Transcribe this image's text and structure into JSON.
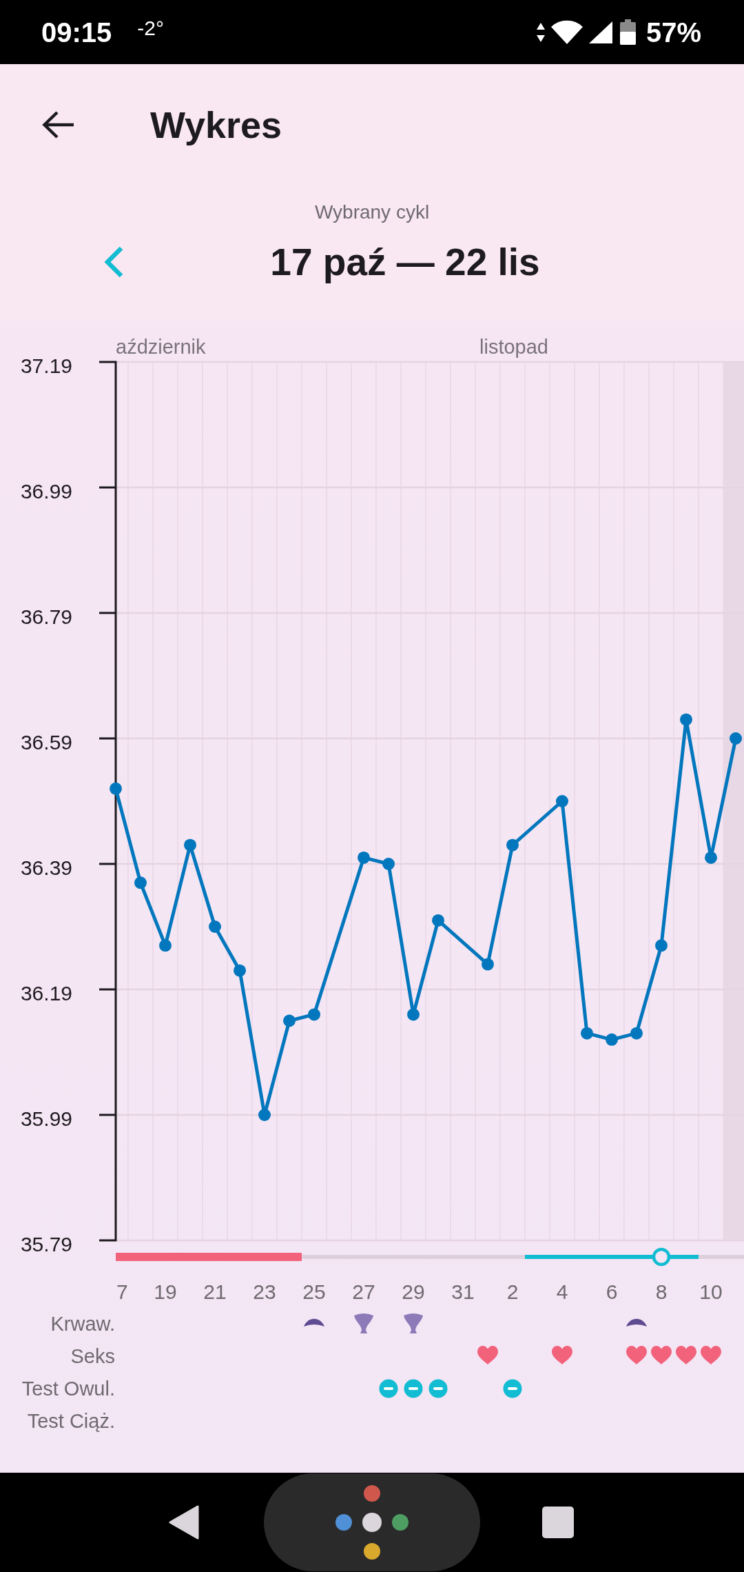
{
  "status_bar": {
    "time": "09:15",
    "temperature": "-2°",
    "battery": "57%"
  },
  "app_bar": {
    "title": "Wykres"
  },
  "cycle_selector": {
    "caption": "Wybrany cykl",
    "range": "17 paź — 22 lis"
  },
  "chart": {
    "chart_data": {
      "type": "line",
      "grid": true,
      "categories": [
        "7",
        null,
        "19",
        null,
        "21",
        null,
        "23",
        null,
        "25",
        null,
        "27",
        null,
        "29",
        null,
        "31",
        null,
        "2",
        null,
        "4",
        null,
        "6",
        null,
        "8",
        null,
        "10",
        null
      ],
      "series": [
        {
          "color": "#0277bd",
          "marker": "circle",
          "values": [
            36.51,
            36.36,
            36.26,
            36.42,
            36.29,
            36.22,
            35.99,
            36.14,
            36.15,
            null,
            36.4,
            36.39,
            36.15,
            36.3,
            null,
            36.23,
            36.42,
            null,
            36.49,
            36.12,
            36.11,
            36.12,
            36.26,
            36.62,
            36.4,
            36.59
          ]
        }
      ],
      "ylim": [
        35.79,
        37.19
      ],
      "yticks": [
        37.19,
        36.99,
        36.79,
        36.59,
        36.39,
        36.19,
        35.99,
        35.79
      ]
    },
    "day_columns": [
      {
        "kind": "plain",
        "month": "aździernik"
      },
      {
        "kind": "plain"
      },
      {
        "kind": "plain"
      },
      {
        "kind": "plain"
      },
      {
        "kind": "plain"
      },
      {
        "kind": "plain"
      },
      {
        "kind": "plain"
      },
      {
        "kind": "plain"
      },
      {
        "kind": "plain"
      },
      {
        "kind": "plain"
      },
      {
        "kind": "plain"
      },
      {
        "kind": "plain"
      },
      {
        "kind": "plain"
      },
      {
        "kind": "plain"
      },
      {
        "kind": "plain"
      },
      {
        "kind": "plain",
        "month": "listopad"
      },
      {
        "kind": "plain"
      },
      {
        "kind": "plain"
      },
      {
        "kind": "plain"
      },
      {
        "kind": "plain"
      },
      {
        "kind": "plain"
      },
      {
        "kind": "plain"
      },
      {
        "kind": "plain"
      },
      {
        "kind": "plain"
      },
      {
        "kind": "plain"
      },
      {
        "kind": "highlighted"
      }
    ],
    "phase_bar": [
      {
        "kind": "period"
      },
      {
        "kind": "period"
      },
      {
        "kind": "period"
      },
      {
        "kind": "period"
      },
      {
        "kind": "period"
      },
      {
        "kind": "period"
      },
      {
        "kind": "period"
      },
      {
        "kind": "period"
      },
      {
        "kind": "none"
      },
      {
        "kind": "none"
      },
      {
        "kind": "none"
      },
      {
        "kind": "none"
      },
      {
        "kind": "none"
      },
      {
        "kind": "none"
      },
      {
        "kind": "none"
      },
      {
        "kind": "none"
      },
      {
        "kind": "none"
      },
      {
        "kind": "fertile"
      },
      {
        "kind": "fertile"
      },
      {
        "kind": "fertile"
      },
      {
        "kind": "fertile"
      },
      {
        "kind": "fertile"
      },
      {
        "kind": "ovulation"
      },
      {
        "kind": "fertile"
      },
      {
        "kind": "none"
      },
      {
        "kind": "none"
      }
    ],
    "event_rows": [
      {
        "label": "Krwaw.",
        "days": [
          {
            "kind": "none"
          },
          {
            "kind": "none"
          },
          {
            "kind": "none"
          },
          {
            "kind": "none"
          },
          {
            "kind": "none"
          },
          {
            "kind": "none"
          },
          {
            "kind": "none"
          },
          {
            "kind": "none"
          },
          {
            "kind": "dome"
          },
          {
            "kind": "none"
          },
          {
            "kind": "goblet"
          },
          {
            "kind": "none"
          },
          {
            "kind": "goblet"
          },
          {
            "kind": "none"
          },
          {
            "kind": "none"
          },
          {
            "kind": "none"
          },
          {
            "kind": "none"
          },
          {
            "kind": "none"
          },
          {
            "kind": "none"
          },
          {
            "kind": "none"
          },
          {
            "kind": "none"
          },
          {
            "kind": "dome"
          },
          {
            "kind": "none"
          },
          {
            "kind": "none"
          },
          {
            "kind": "none"
          },
          {
            "kind": "none"
          }
        ]
      },
      {
        "label": "Seks",
        "days": [
          {
            "kind": "none"
          },
          {
            "kind": "none"
          },
          {
            "kind": "none"
          },
          {
            "kind": "none"
          },
          {
            "kind": "none"
          },
          {
            "kind": "none"
          },
          {
            "kind": "none"
          },
          {
            "kind": "none"
          },
          {
            "kind": "none"
          },
          {
            "kind": "none"
          },
          {
            "kind": "none"
          },
          {
            "kind": "none"
          },
          {
            "kind": "none"
          },
          {
            "kind": "none"
          },
          {
            "kind": "none"
          },
          {
            "kind": "heart"
          },
          {
            "kind": "none"
          },
          {
            "kind": "none"
          },
          {
            "kind": "heart"
          },
          {
            "kind": "none"
          },
          {
            "kind": "none"
          },
          {
            "kind": "heart"
          },
          {
            "kind": "heart"
          },
          {
            "kind": "heart"
          },
          {
            "kind": "heart"
          },
          {
            "kind": "none"
          }
        ]
      },
      {
        "label": "Test Owul.",
        "days": [
          {
            "kind": "none"
          },
          {
            "kind": "none"
          },
          {
            "kind": "none"
          },
          {
            "kind": "none"
          },
          {
            "kind": "none"
          },
          {
            "kind": "none"
          },
          {
            "kind": "none"
          },
          {
            "kind": "none"
          },
          {
            "kind": "none"
          },
          {
            "kind": "none"
          },
          {
            "kind": "none"
          },
          {
            "kind": "negative"
          },
          {
            "kind": "negative"
          },
          {
            "kind": "negative"
          },
          {
            "kind": "none"
          },
          {
            "kind": "none"
          },
          {
            "kind": "negative"
          },
          {
            "kind": "none"
          },
          {
            "kind": "none"
          },
          {
            "kind": "none"
          },
          {
            "kind": "none"
          },
          {
            "kind": "none"
          },
          {
            "kind": "none"
          },
          {
            "kind": "none"
          },
          {
            "kind": "none"
          },
          {
            "kind": "none"
          }
        ]
      },
      {
        "label": "Test Ciąż."
      }
    ]
  }
}
